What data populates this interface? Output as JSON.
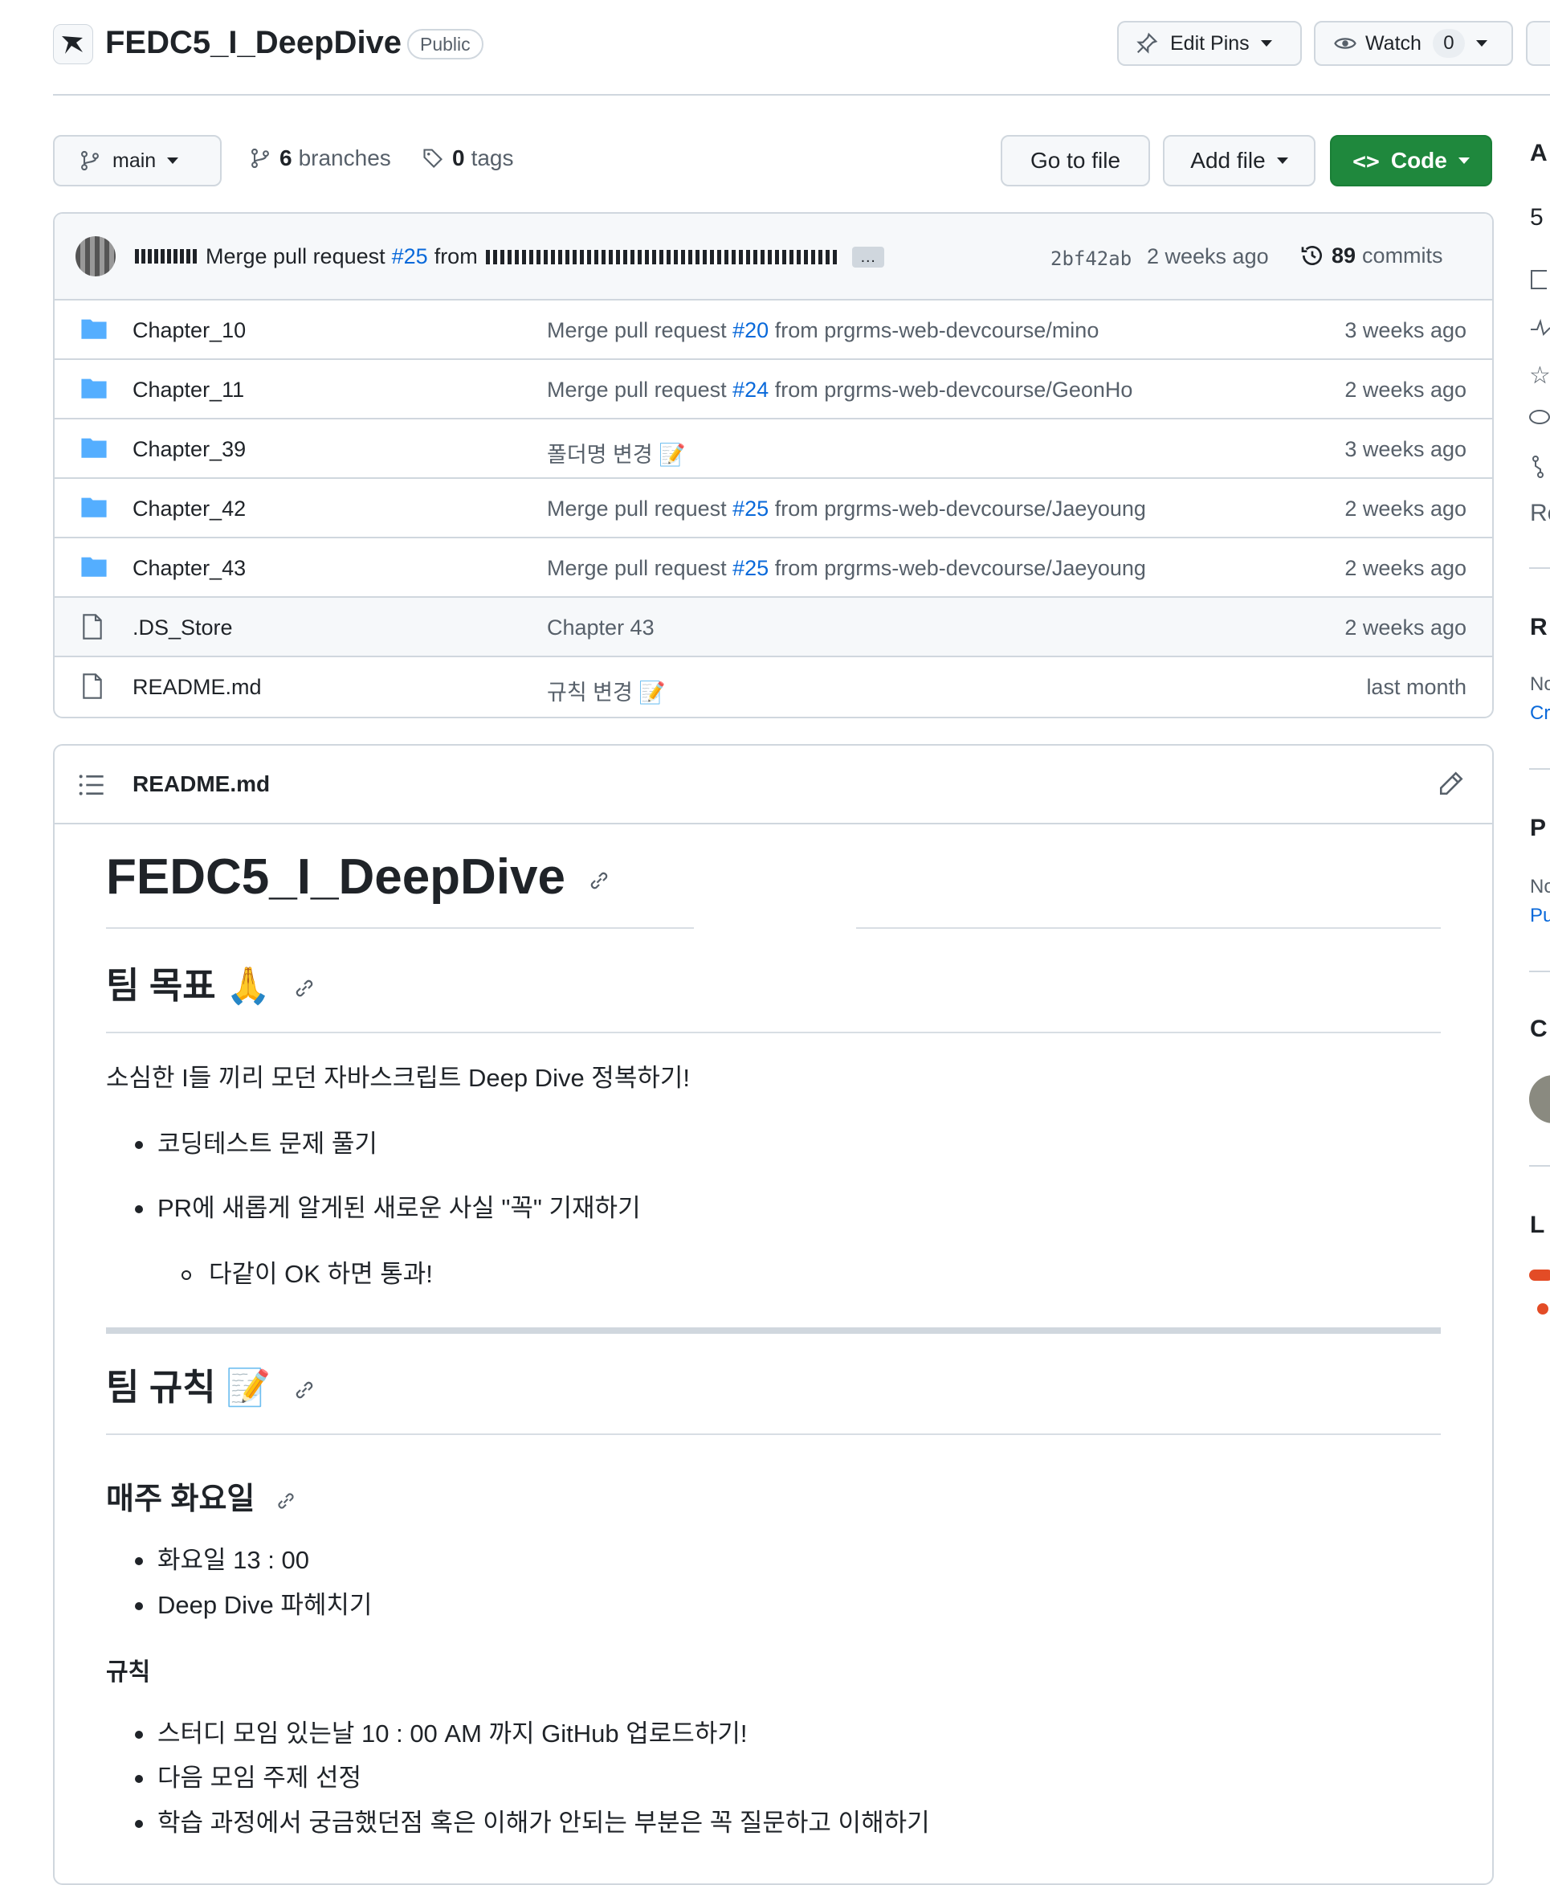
{
  "repo": {
    "name": "FEDC5_I_DeepDive",
    "visibility": "Public"
  },
  "header_actions": {
    "edit_pins": "Edit Pins",
    "watch": "Watch",
    "watch_count": "0"
  },
  "toolbar": {
    "branch": "main",
    "branches_count": "6",
    "branches_label": "branches",
    "tags_count": "0",
    "tags_label": "tags",
    "go_to_file": "Go to file",
    "add_file": "Add file",
    "code": "Code"
  },
  "latest_commit": {
    "message_prefix": "Merge pull request",
    "pr": "#25",
    "from": "from",
    "more": "…",
    "sha": "2bf42ab",
    "time": "2 weeks ago",
    "commits_count": "89",
    "commits_label": "commits"
  },
  "files": [
    {
      "name": "Chapter_10",
      "type": "folder",
      "msg_prefix": "Merge pull request",
      "pr": "#20",
      "msg_suffix": "from prgrms-web-devcourse/mino",
      "time": "3 weeks ago"
    },
    {
      "name": "Chapter_11",
      "type": "folder",
      "msg_prefix": "Merge pull request",
      "pr": "#24",
      "msg_suffix": "from prgrms-web-devcourse/GeonHo",
      "time": "2 weeks ago"
    },
    {
      "name": "Chapter_39",
      "type": "folder",
      "msg_prefix": "폴더명 변경 📝",
      "pr": "",
      "msg_suffix": "",
      "time": "3 weeks ago"
    },
    {
      "name": "Chapter_42",
      "type": "folder",
      "msg_prefix": "Merge pull request",
      "pr": "#25",
      "msg_suffix": "from prgrms-web-devcourse/Jaeyoung",
      "time": "2 weeks ago"
    },
    {
      "name": "Chapter_43",
      "type": "folder",
      "msg_prefix": "Merge pull request",
      "pr": "#25",
      "msg_suffix": "from prgrms-web-devcourse/Jaeyoung",
      "time": "2 weeks ago"
    },
    {
      "name": ".DS_Store",
      "type": "file",
      "msg_prefix": "Chapter 43",
      "pr": "",
      "msg_suffix": "",
      "time": "2 weeks ago"
    },
    {
      "name": "README.md",
      "type": "file",
      "msg_prefix": "규칙 변경 📝",
      "pr": "",
      "msg_suffix": "",
      "time": "last month"
    }
  ],
  "readme": {
    "filename": "README.md",
    "title": "FEDC5_I_DeepDive",
    "goal_heading": "팀 목표 🙏",
    "goal_text": "소심한 I들 끼리 모던 자바스크립트 Deep Dive 정복하기!",
    "goal_items": [
      "코딩테스트 문제 풀기",
      "PR에 새롭게 알게된 새로운 사실 \"꼭\" 기재하기"
    ],
    "goal_subitem": "다같이 OK 하면 통과!",
    "rules_heading": "팀 규칙 📝",
    "weekly_heading": "매주 화요일",
    "weekly_items": [
      "화요일 13 : 00",
      "Deep Dive 파헤치기"
    ],
    "rules_label": "규칙",
    "rules_items": [
      "스터디 모임 있는날 10 : 00 AM 까지 GitHub 업로드하기!",
      "다음 모임 주제 선정",
      "학습 과정에서 궁금했던점 혹은 이해가 안되는 부분은 꼭 질문하고 이해하기"
    ]
  },
  "sidebar": {
    "about": "A",
    "stars_frag": "5",
    "releases": "R",
    "no_text": "No",
    "create": "Cr",
    "packages": "P",
    "publish": "Pu",
    "contrib": "C",
    "languages": "L",
    "re": "Re"
  },
  "colors": {
    "accent": "#0969da",
    "green": "#1f883d",
    "folder": "#54aeff",
    "border": "#d0d7de"
  }
}
